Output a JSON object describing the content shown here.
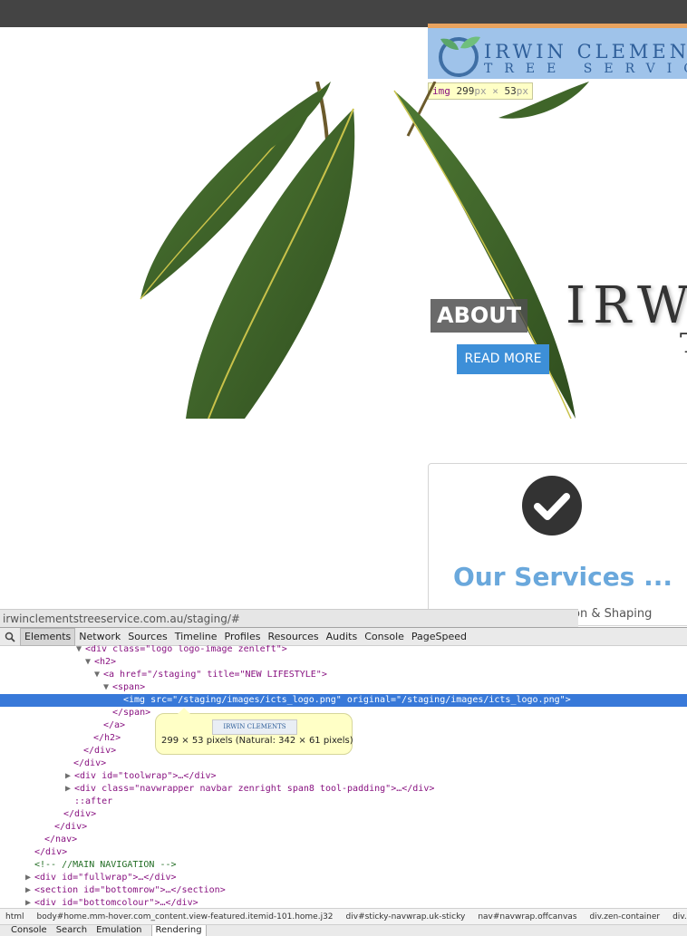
{
  "logo": {
    "line1": "IRWIN CLEMENTS",
    "line2": "TREE SERVICES"
  },
  "img_tooltip": {
    "tag": "img",
    "width": "299",
    "height": "53",
    "unit": "px",
    "times": "×"
  },
  "hero": {
    "title": "ABOUT",
    "button": "READ MORE",
    "wordmark": "IRW",
    "wordmark2": "T"
  },
  "services": {
    "title": "Our Services ...",
    "subtitle": "on & Shaping"
  },
  "status_url": "irwinclementstreeservice.com.au/staging/#",
  "devtools": {
    "tabs": [
      "Elements",
      "Network",
      "Sources",
      "Timeline",
      "Profiles",
      "Resources",
      "Audits",
      "Console",
      "PageSpeed"
    ],
    "lines": [
      "<div class=\"logo logo-image zenleft\">",
      "<h2>",
      "<a href=\"/staging\" title=\"NEW LIFESTYLE\">",
      "<span>",
      "<img src=\"/staging/images/icts_logo.png\" original=\"/staging/images/icts_logo.png\">",
      "</span>",
      "</a>",
      "</h2>",
      "</div>",
      "</div>",
      "<div id=\"toolwrap\">…</div>",
      "<div class=\"navwrapper navbar zenright span8 tool-padding\">…</div>",
      "::after",
      "</div>",
      "</div>",
      "</nav>",
      "</div>",
      "<!-- //MAIN NAVIGATION -->",
      "<div id=\"fullwrap\">…</div>",
      "<section id=\"bottomrow\">…</section>",
      "<div id=\"bottomcolour\">…</div>"
    ],
    "preview": {
      "thumb_text": "IRWIN CLEMENTS",
      "text": "299 × 53 pixels (Natural: 342 × 61 pixels)"
    },
    "breadcrumbs": [
      "html",
      "body#home.mm-hover.com_content.view-featured.itemid-101.home.j32",
      "div#sticky-navwrap.uk-sticky",
      "nav#navwrap.offcanvas",
      "div.zen-container",
      "div.row-fluid"
    ],
    "drawer_tabs": [
      "Console",
      "Search",
      "Emulation",
      "Rendering"
    ]
  },
  "colors": {
    "accent_blue": "#3d8fd8",
    "selection_blue": "#3879d9",
    "services_title": "#6aa8dc"
  }
}
